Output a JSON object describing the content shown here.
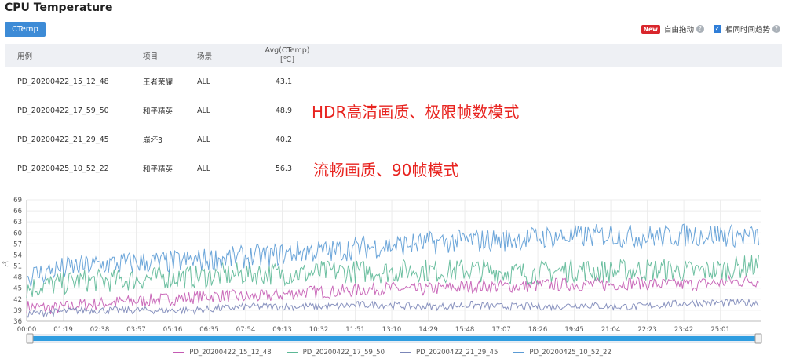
{
  "title": "CPU Temperature",
  "tab_label": "CTemp",
  "controls": {
    "new_badge": "New",
    "free_drag_label": "自由拖动",
    "same_time_label": "相同时间趋势",
    "same_time_checked": true
  },
  "table": {
    "headers": [
      "用例",
      "项目",
      "场景",
      "Avg(CTemp)",
      "[℃]"
    ],
    "rows": [
      {
        "case": "PD_20200422_15_12_48",
        "project": "王者荣耀",
        "scene": "ALL",
        "avg": "43.1"
      },
      {
        "case": "PD_20200422_17_59_50",
        "project": "和平精英",
        "scene": "ALL",
        "avg": "48.9"
      },
      {
        "case": "PD_20200422_21_29_45",
        "project": "崩坏3",
        "scene": "ALL",
        "avg": "40.2"
      },
      {
        "case": "PD_20200425_10_52_22",
        "project": "和平精英",
        "scene": "ALL",
        "avg": "56.3"
      }
    ]
  },
  "annotations": {
    "hdr": "HDR高清画质、极限帧数模式",
    "smooth": "流畅画质、90帧模式"
  },
  "chart_data": {
    "type": "line",
    "ylabel": "℃",
    "ylim": [
      36,
      69
    ],
    "y_ticks": [
      "69",
      "66",
      "63",
      "60",
      "57",
      "54",
      "51",
      "48",
      "45",
      "42",
      "39",
      "36"
    ],
    "x_ticks": [
      "00:00",
      "01:19",
      "02:38",
      "03:57",
      "05:16",
      "06:35",
      "07:54",
      "09:13",
      "10:32",
      "11:51",
      "13:10",
      "14:29",
      "15:48",
      "17:07",
      "18:26",
      "19:45",
      "21:04",
      "22:23",
      "23:42",
      "25:01"
    ],
    "x_max_minutes": 26.5,
    "grid": true,
    "legend_position": "bottom",
    "series": [
      {
        "name": "PD_20200422_15_12_48",
        "color": "#c45ab3",
        "points": [
          [
            0,
            40
          ],
          [
            1,
            39.5
          ],
          [
            2,
            40.5
          ],
          [
            3,
            41
          ],
          [
            4,
            41.5
          ],
          [
            5,
            42
          ],
          [
            6,
            42.5
          ],
          [
            7,
            43
          ],
          [
            8,
            42.5
          ],
          [
            9,
            43
          ],
          [
            10,
            44
          ],
          [
            11,
            44
          ],
          [
            12,
            44.5
          ],
          [
            13,
            45
          ],
          [
            14,
            44.5
          ],
          [
            15,
            45
          ],
          [
            16,
            45.5
          ],
          [
            17,
            45.5
          ],
          [
            18,
            45.5
          ],
          [
            19,
            46
          ],
          [
            20,
            46
          ],
          [
            21,
            46
          ],
          [
            22,
            46.5
          ],
          [
            23,
            46
          ],
          [
            24,
            46
          ],
          [
            25,
            46.5
          ],
          [
            26,
            47
          ]
        ],
        "amp": 1.8
      },
      {
        "name": "PD_20200422_17_59_50",
        "color": "#5cb896",
        "points": [
          [
            0,
            45
          ],
          [
            1,
            46
          ],
          [
            2,
            47
          ],
          [
            3,
            47
          ],
          [
            4,
            47.5
          ],
          [
            5,
            48
          ],
          [
            6,
            48
          ],
          [
            7,
            48.5
          ],
          [
            8,
            49
          ],
          [
            9,
            49
          ],
          [
            10,
            49
          ],
          [
            11,
            49.5
          ],
          [
            12,
            49.5
          ],
          [
            13,
            49.5
          ],
          [
            14,
            50
          ],
          [
            15,
            49.5
          ],
          [
            16,
            50
          ],
          [
            17,
            49.5
          ],
          [
            18,
            49
          ],
          [
            19,
            49.5
          ],
          [
            20,
            50
          ],
          [
            21,
            49.5
          ],
          [
            22,
            50
          ],
          [
            23,
            50
          ],
          [
            24,
            49.5
          ],
          [
            25,
            50
          ],
          [
            26,
            51
          ]
        ],
        "amp": 3.2
      },
      {
        "name": "PD_20200422_21_29_45",
        "color": "#7b86b8",
        "points": [
          [
            0,
            38
          ],
          [
            1,
            38.5
          ],
          [
            2,
            39
          ],
          [
            3,
            39
          ],
          [
            4,
            39
          ],
          [
            5,
            39
          ],
          [
            6,
            39
          ],
          [
            7,
            39.5
          ],
          [
            8,
            40
          ],
          [
            9,
            40
          ],
          [
            10,
            40
          ],
          [
            11,
            40
          ],
          [
            12,
            40.5
          ],
          [
            13,
            40.5
          ],
          [
            14,
            40
          ],
          [
            15,
            40
          ],
          [
            16,
            40.5
          ],
          [
            17,
            40
          ],
          [
            18,
            40
          ],
          [
            19,
            40
          ],
          [
            20,
            40.5
          ],
          [
            21,
            40
          ],
          [
            22,
            40
          ],
          [
            23,
            40.5
          ],
          [
            24,
            41
          ],
          [
            25,
            41
          ],
          [
            26,
            41
          ]
        ],
        "amp": 1.0
      },
      {
        "name": "PD_20200425_10_52_22",
        "color": "#5b9bd5",
        "points": [
          [
            0,
            48
          ],
          [
            1,
            50
          ],
          [
            2,
            51
          ],
          [
            3,
            51.5
          ],
          [
            4,
            52
          ],
          [
            5,
            52
          ],
          [
            6,
            52.5
          ],
          [
            7,
            53
          ],
          [
            8,
            53.5
          ],
          [
            9,
            54
          ],
          [
            10,
            55
          ],
          [
            11,
            55
          ],
          [
            12,
            56
          ],
          [
            13,
            56.5
          ],
          [
            14,
            57
          ],
          [
            15,
            57.5
          ],
          [
            16,
            58
          ],
          [
            17,
            58
          ],
          [
            18,
            58.5
          ],
          [
            19,
            59
          ],
          [
            20,
            59
          ],
          [
            21,
            59.5
          ],
          [
            22,
            59
          ],
          [
            23,
            59
          ],
          [
            24,
            59.5
          ],
          [
            25,
            59.5
          ],
          [
            26,
            59
          ]
        ],
        "amp": 3.2
      }
    ]
  }
}
